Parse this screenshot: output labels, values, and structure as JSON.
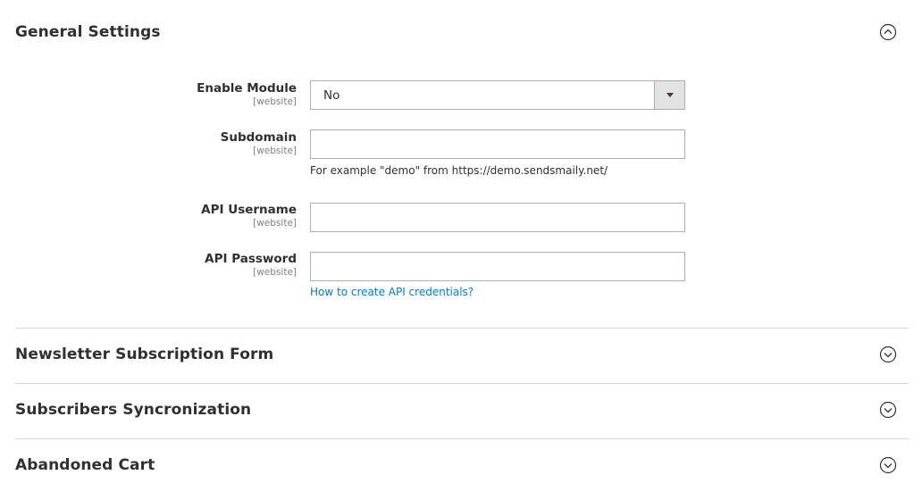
{
  "sections": [
    {
      "title": "General Settings",
      "state": "expanded",
      "icon": "chevron-up-circle-icon"
    },
    {
      "title": "Newsletter Subscription Form",
      "state": "collapsed",
      "icon": "chevron-down-circle-icon"
    },
    {
      "title": "Subscribers Syncronization",
      "state": "collapsed",
      "icon": "chevron-down-circle-icon"
    },
    {
      "title": "Abandoned Cart",
      "state": "collapsed",
      "icon": "chevron-down-circle-icon"
    }
  ],
  "general": {
    "enable_module": {
      "label": "Enable Module",
      "scope": "[website]",
      "value": "No"
    },
    "subdomain": {
      "label": "Subdomain",
      "scope": "[website]",
      "value": "",
      "note": "For example \"demo\" from https://demo.sendsmaily.net/"
    },
    "api_username": {
      "label": "API Username",
      "scope": "[website]",
      "value": ""
    },
    "api_password": {
      "label": "API Password",
      "scope": "[website]",
      "value": "",
      "link": "How to create API credentials?"
    }
  },
  "colors": {
    "link": "#007bdb",
    "text": "#303030",
    "scope": "#808080",
    "border": "#adadad",
    "divider": "#d6d6d6"
  }
}
